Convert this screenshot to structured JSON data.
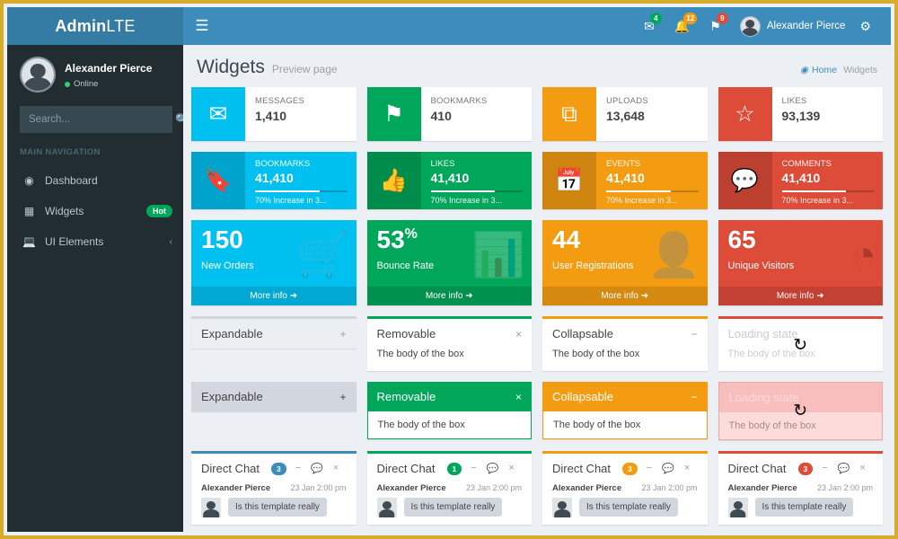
{
  "brand": {
    "bold": "Admin",
    "light": "LTE"
  },
  "navbar": {
    "hamburger_icon": "bars-icon",
    "icons": [
      {
        "name": "messages-icon",
        "glyph": "✉",
        "badge": "4",
        "color": "green"
      },
      {
        "name": "notifications-icon",
        "glyph": "🔔",
        "badge": "12",
        "color": "yellow"
      },
      {
        "name": "tasks-icon",
        "glyph": "⚑",
        "badge": "9",
        "color": "red"
      }
    ],
    "user_name": "Alexander Pierce",
    "settings_icon": "gears-icon"
  },
  "sidebar": {
    "user": {
      "name": "Alexander Pierce",
      "status": "Online"
    },
    "search": {
      "placeholder": "Search...",
      "value": "",
      "icon": "search-icon"
    },
    "nav_header": "MAIN NAVIGATION",
    "items": [
      {
        "label": "Dashboard",
        "icon": "dashboard-icon",
        "glyph": "☸",
        "badge": "",
        "chevron": ""
      },
      {
        "label": "Widgets",
        "icon": "widgets-icon",
        "glyph": "▓",
        "badge": "Hot",
        "chevron": ""
      },
      {
        "label": "UI Elements",
        "icon": "laptop-icon",
        "glyph": "⌨",
        "badge": "",
        "chevron": "‹"
      }
    ]
  },
  "page": {
    "title": "Widgets",
    "subtitle": "Preview page",
    "breadcrumb": {
      "home": "Home",
      "home_icon": "dashboard-icon",
      "current": "Widgets"
    }
  },
  "info_boxes": [
    {
      "title": "MESSAGES",
      "number": "1,410",
      "icon": "envelope-icon",
      "glyph": "✉",
      "color": "#00c0ef"
    },
    {
      "title": "BOOKMARKS",
      "number": "410",
      "icon": "flag-icon",
      "glyph": "⚑",
      "color": "#00a65a"
    },
    {
      "title": "UPLOADS",
      "number": "13,648",
      "icon": "copy-icon",
      "glyph": "⧉",
      "color": "#f39c12"
    },
    {
      "title": "LIKES",
      "number": "93,139",
      "icon": "star-icon",
      "glyph": "☆",
      "color": "#dd4b39"
    }
  ],
  "info_boxes_progress": [
    {
      "title": "BOOKMARKS",
      "number": "41,410",
      "desc": "70% Increase in 3...",
      "progress": 70,
      "icon": "bookmark-icon",
      "glyph": "🔖",
      "color": "#00c0ef"
    },
    {
      "title": "LIKES",
      "number": "41,410",
      "desc": "70% Increase in 3...",
      "progress": 70,
      "icon": "thumbs-up-icon",
      "glyph": "👍",
      "color": "#00a65a"
    },
    {
      "title": "EVENTS",
      "number": "41,410",
      "desc": "70% Increase in 3...",
      "progress": 70,
      "icon": "calendar-icon",
      "glyph": "📅",
      "color": "#f39c12"
    },
    {
      "title": "COMMENTS",
      "number": "41,410",
      "desc": "70% Increase in 3...",
      "progress": 70,
      "icon": "comments-icon",
      "glyph": "💬",
      "color": "#dd4b39"
    }
  ],
  "small_boxes": [
    {
      "number": "150",
      "sup": "",
      "text": "New Orders",
      "footer": "More info",
      "icon": "shopping-cart-icon",
      "glyph": "🛒",
      "color": "#00c0ef"
    },
    {
      "number": "53",
      "sup": "%",
      "text": "Bounce Rate",
      "footer": "More info",
      "icon": "bar-chart-icon",
      "glyph": "📊",
      "color": "#00a65a"
    },
    {
      "number": "44",
      "sup": "",
      "text": "User Registrations",
      "footer": "More info",
      "icon": "user-plus-icon",
      "glyph": "👤",
      "color": "#f39c12"
    },
    {
      "number": "65",
      "sup": "",
      "text": "Unique Visitors",
      "footer": "More info",
      "icon": "pie-chart-icon",
      "glyph": "◔",
      "color": "#dd4b39"
    }
  ],
  "boxes": [
    {
      "title": "Expandable",
      "body": "",
      "tool": "+",
      "tool_icon": "plus-icon",
      "color": "#d2d6de",
      "state": "collapsed"
    },
    {
      "title": "Removable",
      "body": "The body of the box",
      "tool": "×",
      "tool_icon": "close-icon",
      "color": "#00a65a",
      "state": "normal"
    },
    {
      "title": "Collapsable",
      "body": "The body of the box",
      "tool": "−",
      "tool_icon": "minus-icon",
      "color": "#f39c12",
      "state": "normal"
    },
    {
      "title": "Loading state",
      "body": "The body of the box",
      "tool": "",
      "tool_icon": "",
      "color": "#dd4b39",
      "state": "loading",
      "spinner_icon": "refresh-icon"
    }
  ],
  "solid_boxes": [
    {
      "title": "Expandable",
      "body": "",
      "tool": "+",
      "tool_icon": "plus-icon",
      "color": "#d2d6de",
      "header_text": "#444",
      "state": "collapsed"
    },
    {
      "title": "Removable",
      "body": "The body of the box",
      "tool": "×",
      "tool_icon": "close-icon",
      "color": "#00a65a",
      "header_text": "#fff",
      "state": "normal"
    },
    {
      "title": "Collapsable",
      "body": "The body of the box",
      "tool": "−",
      "tool_icon": "minus-icon",
      "color": "#f39c12",
      "header_text": "#fff",
      "state": "normal"
    },
    {
      "title": "Loading state",
      "body": "The body of the box",
      "tool": "",
      "tool_icon": "",
      "color": "#f8c4c4",
      "header_text": "#fff",
      "state": "loading",
      "spinner_icon": "refresh-icon"
    }
  ],
  "direct_chats": [
    {
      "title": "Direct Chat",
      "badge": "3",
      "color": "#3c8dbc",
      "author": "Alexander Pierce",
      "time": "23 Jan 2:00 pm",
      "message": "Is this template really"
    },
    {
      "title": "Direct Chat",
      "badge": "1",
      "color": "#00a65a",
      "author": "Alexander Pierce",
      "time": "23 Jan 2:00 pm",
      "message": "Is this template really"
    },
    {
      "title": "Direct Chat",
      "badge": "3",
      "color": "#f39c12",
      "author": "Alexander Pierce",
      "time": "23 Jan 2:00 pm",
      "message": "Is this template really"
    },
    {
      "title": "Direct Chat",
      "badge": "3",
      "color": "#dd4b39",
      "author": "Alexander Pierce",
      "time": "23 Jan 2:00 pm",
      "message": "Is this template really"
    }
  ],
  "chat_tools": {
    "minus": "−",
    "comments": "💬",
    "close": "×"
  }
}
